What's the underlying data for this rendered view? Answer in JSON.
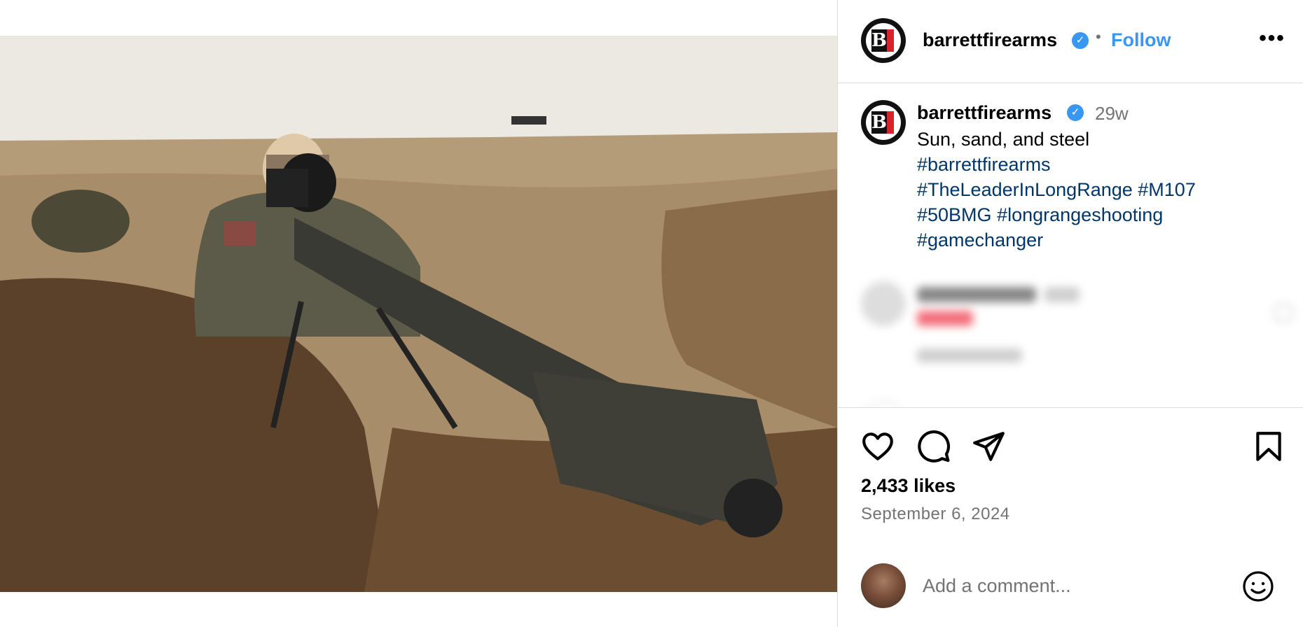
{
  "post": {
    "username": "barrettfirearms",
    "verified_icon": "verified-badge-icon",
    "follow_label": "Follow",
    "separator": "•",
    "more_label": "•••",
    "caption": {
      "username": "barrettfirearms",
      "time": "29w",
      "text": "Sun, sand, and steel",
      "hashtags": [
        "#barrettfirearms",
        "#TheLeaderInLongRange",
        "#M107",
        "#50BMG",
        "#longrangeshooting",
        "#gamechanger"
      ]
    },
    "likes": "2,433 likes",
    "date": "September 6, 2024",
    "comment_placeholder": "Add a comment...",
    "logo_letter": "B"
  },
  "colors": {
    "accent": "#3897f0",
    "hashtag": "#00376b",
    "muted": "#737373",
    "brand_red": "#d8232a"
  },
  "icons": [
    "heart-icon",
    "comment-icon",
    "share-icon",
    "bookmark-icon",
    "emoji-icon",
    "more-icon"
  ]
}
